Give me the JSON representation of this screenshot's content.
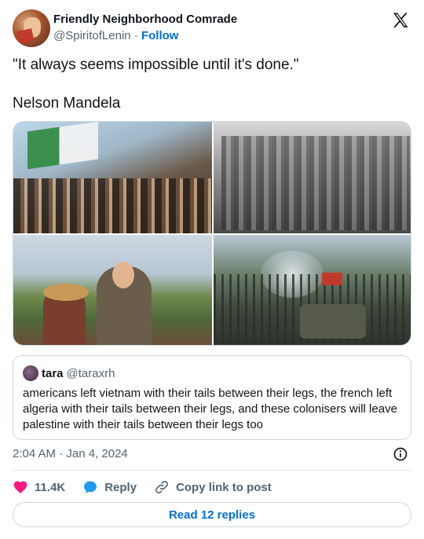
{
  "author": {
    "display_name": "Friendly Neighborhood Comrade",
    "handle": "@SpiritofLenin",
    "separator": "·",
    "follow_label": "Follow"
  },
  "tweet": {
    "line1": "\"It always seems impossible until it's done.\"",
    "line2": "Nelson Mandela"
  },
  "media": {
    "images": [
      "photo-1",
      "photo-2",
      "photo-3",
      "photo-4"
    ]
  },
  "quoted": {
    "name": "tara",
    "handle": "@taraxrh",
    "text": "americans left vietnam with their tails between their legs, the french left algeria with their tails between their legs, and these colonisers will leave palestine with their tails between their legs too"
  },
  "meta": {
    "timestamp": "2:04 AM · Jan 4, 2024"
  },
  "actions": {
    "likes": "11.4K",
    "reply_label": "Reply",
    "copy_label": "Copy link to post"
  },
  "read_replies_label": "Read 12 replies",
  "colors": {
    "accent": "#006fd6",
    "like": "#f91880",
    "reply_icon": "#1d9bf0",
    "muted": "#536471",
    "border": "#cfd9de"
  },
  "icons": {
    "logo": "x-logo-icon",
    "info": "info-icon",
    "like": "heart-icon",
    "reply": "speech-bubble-icon",
    "copy": "link-icon"
  }
}
